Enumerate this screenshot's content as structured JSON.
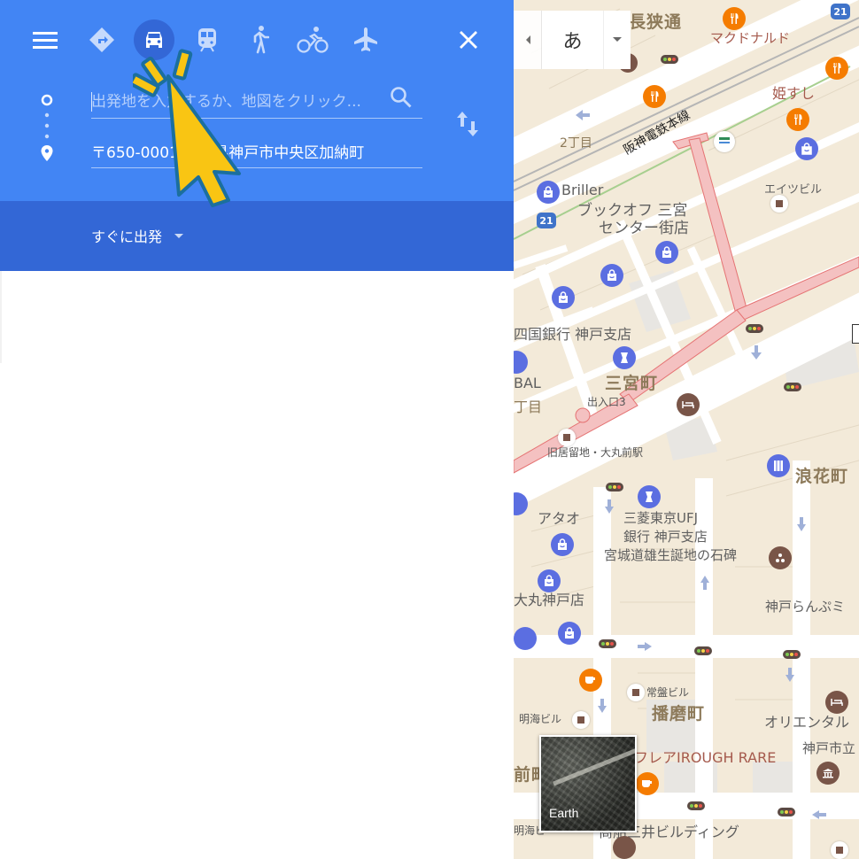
{
  "panel": {
    "modes": [
      {
        "name": "best-route",
        "icon": "directions-icon",
        "active": false
      },
      {
        "name": "driving",
        "icon": "car-icon",
        "active": true
      },
      {
        "name": "transit",
        "icon": "train-icon",
        "active": false
      },
      {
        "name": "walking",
        "icon": "walk-icon",
        "active": false
      },
      {
        "name": "cycling",
        "icon": "bike-icon",
        "active": false
      },
      {
        "name": "flights",
        "icon": "airplane-icon",
        "active": false
      }
    ],
    "origin": {
      "value": "",
      "placeholder": "出発地を入力するか、地図をクリック..."
    },
    "destination": {
      "value": "〒650-0001 兵庫県神戸市中央区加納町",
      "placeholder": ""
    },
    "depart_label": "すぐに出発",
    "colors": {
      "header": "#4285f4",
      "subheader": "#3367d6"
    }
  },
  "ime": {
    "char": "あ"
  },
  "map": {
    "labels": {
      "nagasa": "長狭通",
      "mcdonalds": "マクドナルド",
      "himesushi": "姫すし",
      "hanshin": "阪神電鉄本線",
      "chome2": "2丁目",
      "briller": "Briller",
      "bookoff1": "ブックオフ 三宮",
      "bookoff2": "センター街店",
      "eitsu": "エイツビル",
      "shikoku": "四国銀行 神戸支店",
      "bal": "BAL",
      "chome": "丁目",
      "sannomiya": "三宮町",
      "exit3": "出入口3",
      "kyukyoryuchi": "旧居留地・大丸前駅",
      "naniwa": "浪花町",
      "atao": "アタオ",
      "mufg1": "三菱東京UFJ",
      "mufg2": "銀行 神戸支店",
      "miyagi": "宮城道雄生誕地の石碑",
      "daimaru": "大丸神戸店",
      "ranbu": "神戸らんぷミ",
      "tokiwa": "常盤ビル",
      "harima": "播磨町",
      "meikai": "明海ビル",
      "oriental": "オリエンタル",
      "kobeshi": "神戸市立",
      "rough": "フレアIROUGH RARE",
      "maemachi": "前町",
      "mitsui": "商船三井ビルディング",
      "meikai2": "明海ビ"
    },
    "route_number": "21",
    "earth_label": "Earth"
  }
}
